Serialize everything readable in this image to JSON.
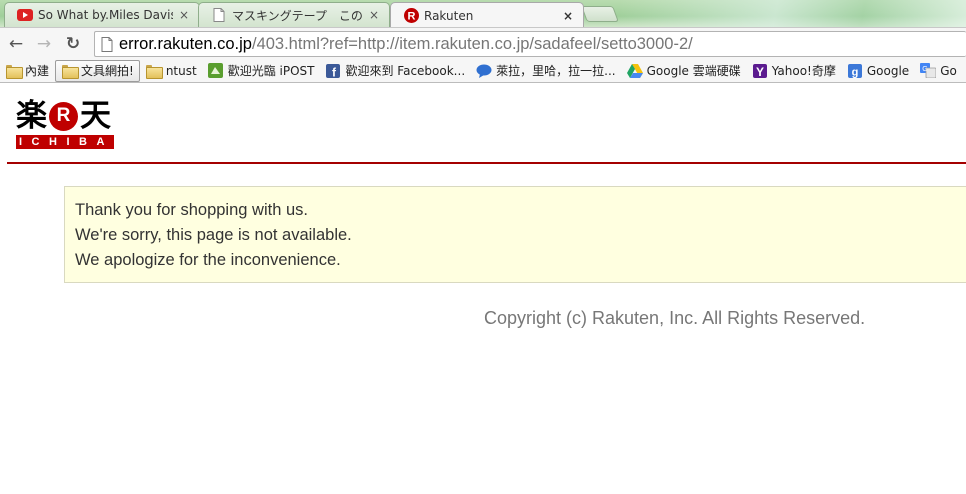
{
  "tabs": [
    {
      "title": "So What by.Miles Davis",
      "icon": "youtube-icon",
      "close": "×",
      "active": false
    },
    {
      "title": "マスキングテープ　この",
      "icon": "blank-page-icon",
      "close": "×",
      "active": false
    },
    {
      "title": "Rakuten",
      "icon": "rakuten-r-icon",
      "close": "×",
      "active": true
    }
  ],
  "toolbar": {
    "back_icon": "←",
    "forward_icon": "→",
    "reload_icon": "↻",
    "url_host": "error.rakuten.co.jp",
    "url_path": "/403.html?ref=http://item.rakuten.co.jp/sadafeel/setto3000-2/"
  },
  "bookmarks": [
    {
      "label": "內建",
      "icon": "folder-icon"
    },
    {
      "label": "文具網拍!",
      "icon": "folder-icon",
      "highlight": true
    },
    {
      "label": "ntust",
      "icon": "folder-icon"
    },
    {
      "label": "歡迎光臨 iPOST",
      "icon": "ipost-icon"
    },
    {
      "label": "歡迎來到 Facebook...",
      "icon": "facebook-icon"
    },
    {
      "label": "萊拉，里哈，拉一拉...",
      "icon": "chat-bubble-icon"
    },
    {
      "label": "Google 雲端硬碟",
      "icon": "google-drive-icon"
    },
    {
      "label": "Yahoo!奇摩",
      "icon": "yahoo-icon"
    },
    {
      "label": "Google",
      "icon": "google-icon"
    },
    {
      "label": "Go",
      "icon": "translate-icon"
    }
  ],
  "logo": {
    "kanji_left": "楽",
    "r_mark": "R",
    "kanji_right": "天",
    "sub": "ICHIBA"
  },
  "message": {
    "line1": "Thank you for shopping with us.",
    "line2": "We're sorry, this page is not available.",
    "line3": "We apologize for the inconvenience."
  },
  "footer": {
    "copyright": "Copyright (c) Rakuten, Inc. All Rights Reserved."
  },
  "colors": {
    "brand_red": "#bf0000",
    "message_bg": "#ffffe0",
    "divider": "#a40000"
  }
}
